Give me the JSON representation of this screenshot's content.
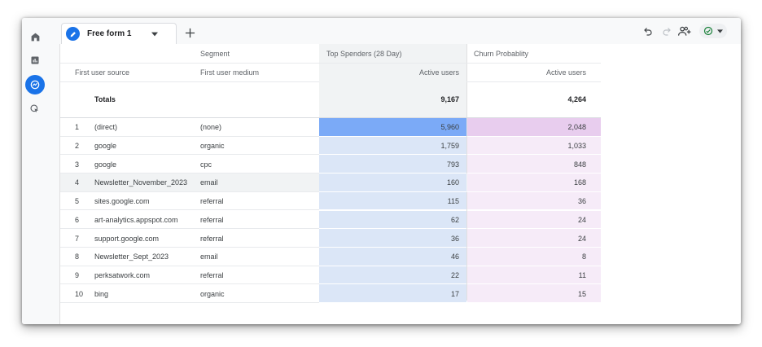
{
  "tab": {
    "label": "Free form 1"
  },
  "table": {
    "dim_header": "Segment",
    "segments": [
      "Top Spenders (28 Day)",
      "Churn Probablity"
    ],
    "columns": [
      "First user source",
      "First user medium",
      "Active users",
      "Active users"
    ],
    "totals": {
      "label": "Totals",
      "values": [
        "9,167",
        "4,264"
      ]
    },
    "rows": [
      {
        "idx": "1",
        "source": "(direct)",
        "medium": "(none)",
        "a": "5,960",
        "b": "2,048",
        "a_level": 1.0,
        "b_level": 1.0
      },
      {
        "idx": "2",
        "source": "google",
        "medium": "organic",
        "a": "1,759",
        "b": "1,033",
        "a_level": 0.3,
        "b_level": 0.3
      },
      {
        "idx": "3",
        "source": "google",
        "medium": "cpc",
        "a": "793",
        "b": "848",
        "a_level": 0.3,
        "b_level": 0.3
      },
      {
        "idx": "4",
        "source": "Newsletter_November_2023",
        "medium": "email",
        "a": "160",
        "b": "168",
        "a_level": 0.3,
        "b_level": 0.3
      },
      {
        "idx": "5",
        "source": "sites.google.com",
        "medium": "referral",
        "a": "115",
        "b": "36",
        "a_level": 0.3,
        "b_level": 0.3
      },
      {
        "idx": "6",
        "source": "art-analytics.appspot.com",
        "medium": "referral",
        "a": "62",
        "b": "24",
        "a_level": 0.3,
        "b_level": 0.3
      },
      {
        "idx": "7",
        "source": "support.google.com",
        "medium": "referral",
        "a": "36",
        "b": "24",
        "a_level": 0.3,
        "b_level": 0.3
      },
      {
        "idx": "8",
        "source": "Newsletter_Sept_2023",
        "medium": "email",
        "a": "46",
        "b": "8",
        "a_level": 0.3,
        "b_level": 0.3
      },
      {
        "idx": "9",
        "source": "perksatwork.com",
        "medium": "referral",
        "a": "22",
        "b": "11",
        "a_level": 0.3,
        "b_level": 0.3
      },
      {
        "idx": "10",
        "source": "bing",
        "medium": "organic",
        "a": "17",
        "b": "15",
        "a_level": 0.3,
        "b_level": 0.3
      }
    ]
  },
  "colors": {
    "accent": "#1a73e8",
    "blue_strong": "#7baaf7",
    "blue_light": "#dbe6f7",
    "pink_strong": "#e8cdee",
    "pink_light": "#f6ebf8",
    "hover_row": "#f1f3f4",
    "totals_bg": "#f1f3f4"
  },
  "icons": {
    "rail": [
      "home-icon",
      "reports-icon",
      "explore-icon",
      "advertising-icon"
    ],
    "toolbar": [
      "undo-icon",
      "redo-icon",
      "share-icon",
      "status-check-icon"
    ]
  }
}
